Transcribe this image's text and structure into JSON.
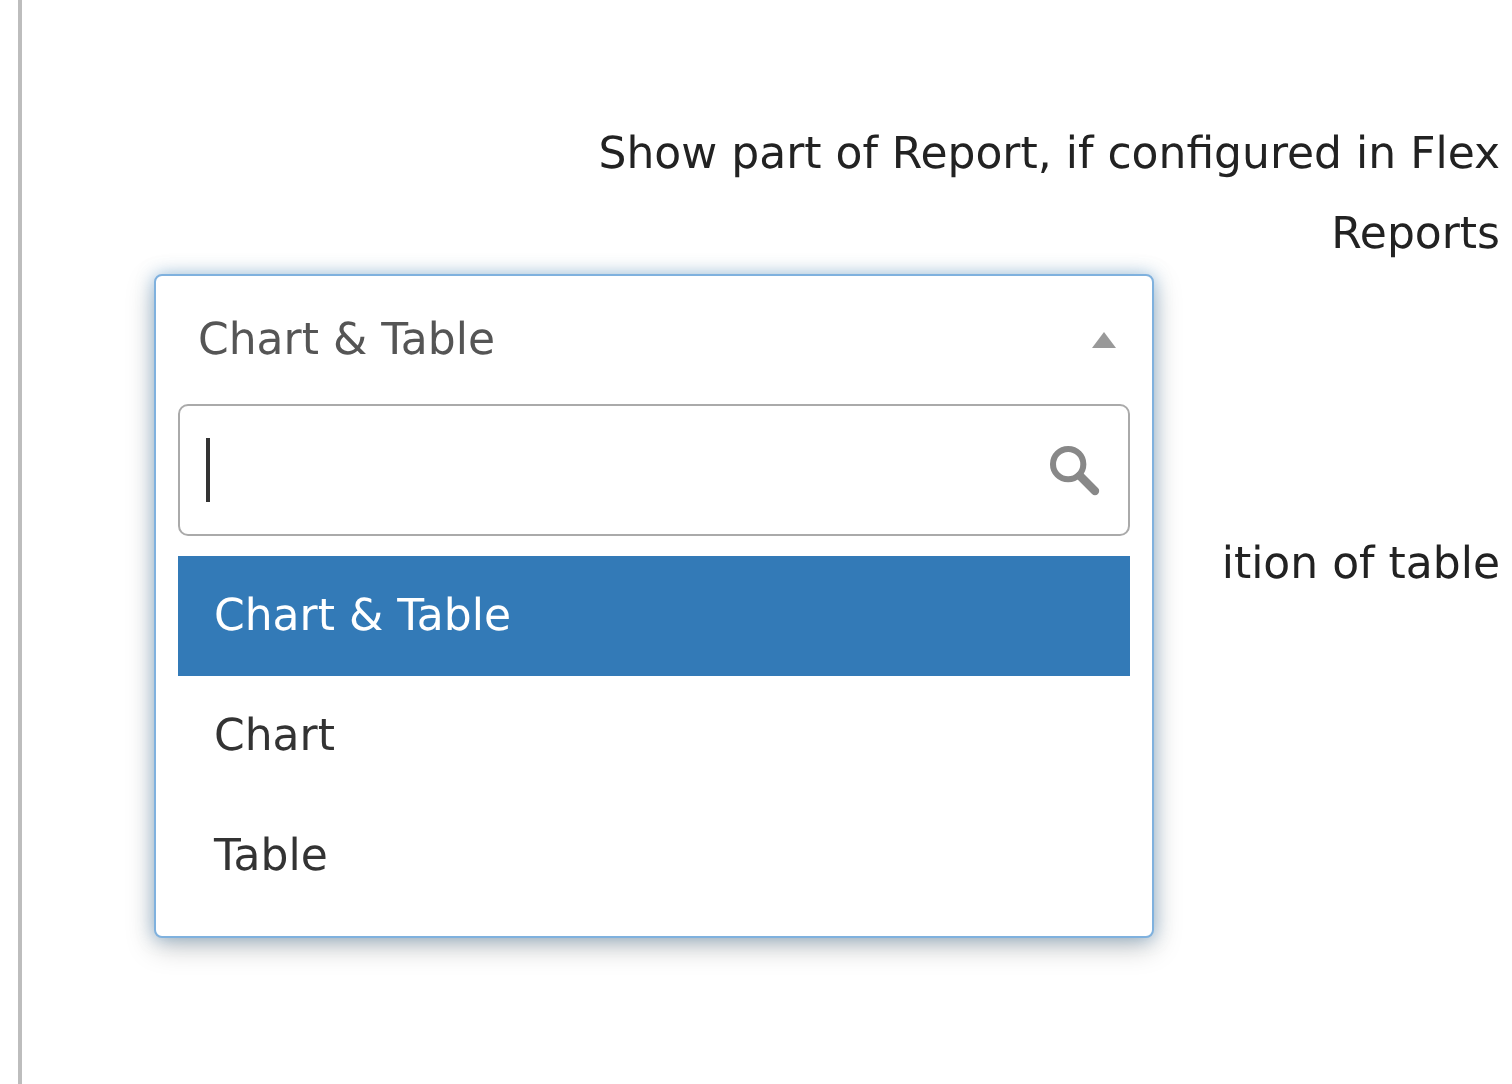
{
  "description": {
    "lines": [
      "Show part of Report, if configured in Flex",
      "Reports"
    ]
  },
  "partial_label": "ition of table",
  "dropdown": {
    "value": "Chart & Table",
    "expanded": true,
    "options": [
      {
        "label": "Chart & Table",
        "selected": true
      },
      {
        "label": "Chart",
        "selected": false
      },
      {
        "label": "Table",
        "selected": false
      }
    ]
  }
}
